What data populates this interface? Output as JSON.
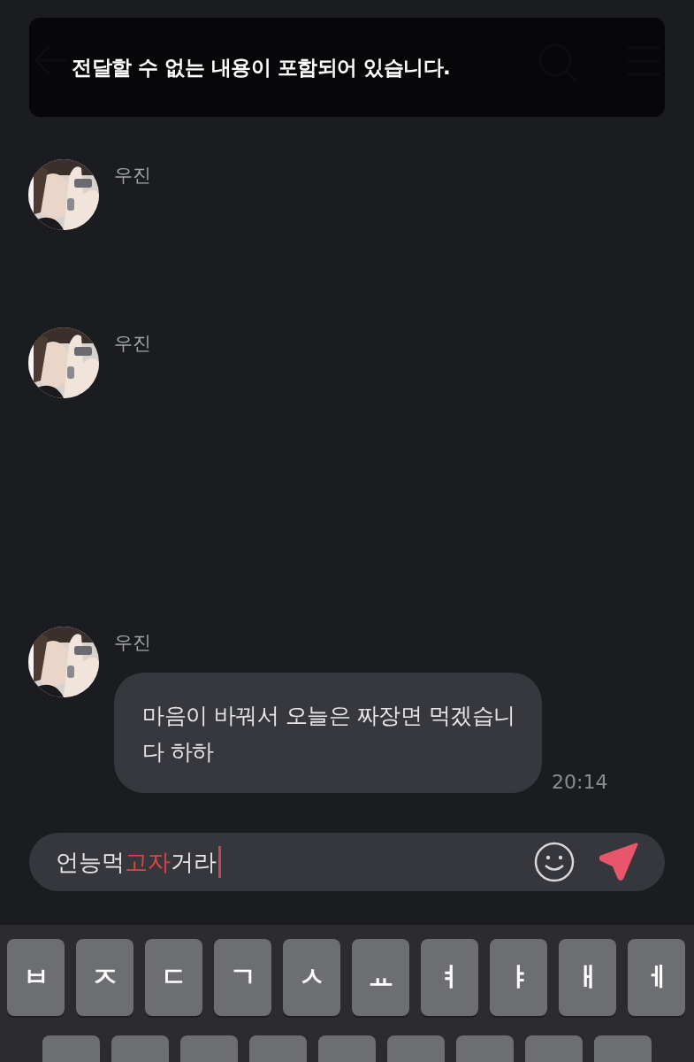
{
  "toast": {
    "message": "전달할 수 없는 내용이 포함되어 있습니다."
  },
  "messages": [
    {
      "sender": "우진"
    },
    {
      "sender": "우진"
    },
    {
      "sender": "우진",
      "text": "마음이 바꿔서 오늘은 짜장면 먹겠습니다 하하",
      "time": "20:14"
    }
  ],
  "input": {
    "segments": [
      {
        "text": "언능먹",
        "highlighted": false
      },
      {
        "text": "고자",
        "highlighted": true
      },
      {
        "text": "거라",
        "highlighted": false
      }
    ]
  },
  "keyboard": {
    "row_1": [
      "ㅂ",
      "ㅈ",
      "ㄷ",
      "ㄱ",
      "ㅅ",
      "ㅛ",
      "ㅕ",
      "ㅑ",
      "ㅐ",
      "ㅔ"
    ]
  }
}
